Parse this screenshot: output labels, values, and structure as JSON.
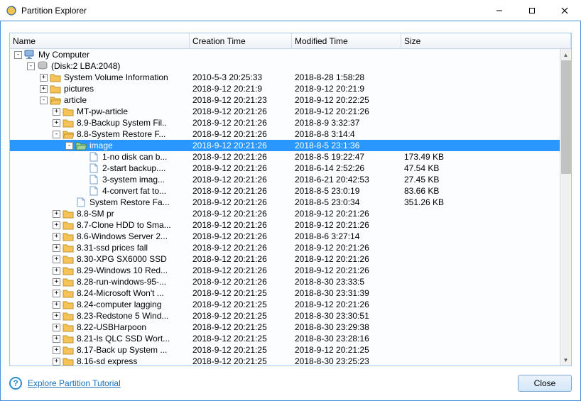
{
  "window": {
    "title": "Partition Explorer"
  },
  "columns": {
    "name": "Name",
    "ctime": "Creation Time",
    "mtime": "Modified Time",
    "size": "Size"
  },
  "footer": {
    "link": "Explore Partition Tutorial",
    "close": "Close"
  },
  "tree": [
    {
      "depth": 0,
      "exp": "-",
      "icon": "comp",
      "label": "My Computer",
      "ctime": "",
      "mtime": "",
      "size": ""
    },
    {
      "depth": 1,
      "exp": "-",
      "icon": "disk",
      "label": "(Disk:2 LBA:2048)",
      "ctime": "",
      "mtime": "",
      "size": ""
    },
    {
      "depth": 2,
      "exp": "+",
      "icon": "folder",
      "label": "System Volume Information",
      "ctime": "2010-5-3 20:25:33",
      "mtime": "2018-8-28 1:58:28",
      "size": ""
    },
    {
      "depth": 2,
      "exp": "+",
      "icon": "folder",
      "label": "pictures",
      "ctime": "2018-9-12 20:21:9",
      "mtime": "2018-9-12 20:21:9",
      "size": ""
    },
    {
      "depth": 2,
      "exp": "-",
      "icon": "folder-open",
      "label": "article",
      "ctime": "2018-9-12 20:21:23",
      "mtime": "2018-9-12 20:22:25",
      "size": ""
    },
    {
      "depth": 3,
      "exp": "+",
      "icon": "folder",
      "label": "MT-pw-article",
      "ctime": "2018-9-12 20:21:26",
      "mtime": "2018-9-12 20:21:26",
      "size": ""
    },
    {
      "depth": 3,
      "exp": "+",
      "icon": "folder",
      "label": "8.9-Backup System Fil..",
      "ctime": "2018-9-12 20:21:26",
      "mtime": "2018-8-9 3:32:37",
      "size": ""
    },
    {
      "depth": 3,
      "exp": "-",
      "icon": "folder-open",
      "label": "8.8-System Restore F...",
      "ctime": "2018-9-12 20:21:26",
      "mtime": "2018-8-8 3:14:4",
      "size": ""
    },
    {
      "depth": 4,
      "exp": "-",
      "icon": "folder-open",
      "label": "image",
      "ctime": "2018-9-12 20:21:26",
      "mtime": "2018-8-5 23:1:36",
      "size": "",
      "selected": true
    },
    {
      "depth": 5,
      "exp": "",
      "icon": "file",
      "label": "1-no disk can b...",
      "ctime": "2018-9-12 20:21:26",
      "mtime": "2018-8-5 19:22:47",
      "size": "173.49 KB"
    },
    {
      "depth": 5,
      "exp": "",
      "icon": "file",
      "label": "2-start backup....",
      "ctime": "2018-9-12 20:21:26",
      "mtime": "2018-6-14 2:52:26",
      "size": "47.54 KB"
    },
    {
      "depth": 5,
      "exp": "",
      "icon": "file",
      "label": "3-system imag...",
      "ctime": "2018-9-12 20:21:26",
      "mtime": "2018-6-21 20:42:53",
      "size": "27.45 KB"
    },
    {
      "depth": 5,
      "exp": "",
      "icon": "file",
      "label": "4-convert fat to...",
      "ctime": "2018-9-12 20:21:26",
      "mtime": "2018-8-5 23:0:19",
      "size": "83.66 KB"
    },
    {
      "depth": 4,
      "exp": "",
      "icon": "file",
      "label": "System Restore Fa...",
      "ctime": "2018-9-12 20:21:26",
      "mtime": "2018-8-5 23:0:34",
      "size": "351.26 KB"
    },
    {
      "depth": 3,
      "exp": "+",
      "icon": "folder",
      "label": "8.8-SM pr",
      "ctime": "2018-9-12 20:21:26",
      "mtime": "2018-9-12 20:21:26",
      "size": ""
    },
    {
      "depth": 3,
      "exp": "+",
      "icon": "folder",
      "label": "8.7-Clone HDD to Sma...",
      "ctime": "2018-9-12 20:21:26",
      "mtime": "2018-9-12 20:21:26",
      "size": ""
    },
    {
      "depth": 3,
      "exp": "+",
      "icon": "folder",
      "label": "8.6-Windows Server 2...",
      "ctime": "2018-9-12 20:21:26",
      "mtime": "2018-8-6 3:27:14",
      "size": ""
    },
    {
      "depth": 3,
      "exp": "+",
      "icon": "folder",
      "label": "8.31-ssd prices fall",
      "ctime": "2018-9-12 20:21:26",
      "mtime": "2018-9-12 20:21:26",
      "size": ""
    },
    {
      "depth": 3,
      "exp": "+",
      "icon": "folder",
      "label": "8.30-XPG SX6000 SSD",
      "ctime": "2018-9-12 20:21:26",
      "mtime": "2018-9-12 20:21:26",
      "size": ""
    },
    {
      "depth": 3,
      "exp": "+",
      "icon": "folder",
      "label": "8.29-Windows 10 Red...",
      "ctime": "2018-9-12 20:21:26",
      "mtime": "2018-9-12 20:21:26",
      "size": ""
    },
    {
      "depth": 3,
      "exp": "+",
      "icon": "folder",
      "label": "8.28-run-windows-95-...",
      "ctime": "2018-9-12 20:21:26",
      "mtime": "2018-8-30 23:33:5",
      "size": ""
    },
    {
      "depth": 3,
      "exp": "+",
      "icon": "folder",
      "label": "8.24-Microsoft Won't ...",
      "ctime": "2018-9-12 20:21:25",
      "mtime": "2018-8-30 23:31:39",
      "size": ""
    },
    {
      "depth": 3,
      "exp": "+",
      "icon": "folder",
      "label": "8.24-computer lagging",
      "ctime": "2018-9-12 20:21:25",
      "mtime": "2018-9-12 20:21:26",
      "size": ""
    },
    {
      "depth": 3,
      "exp": "+",
      "icon": "folder",
      "label": "8.23-Redstone 5 Wind...",
      "ctime": "2018-9-12 20:21:25",
      "mtime": "2018-8-30 23:30:51",
      "size": ""
    },
    {
      "depth": 3,
      "exp": "+",
      "icon": "folder",
      "label": "8.22-USBHarpoon",
      "ctime": "2018-9-12 20:21:25",
      "mtime": "2018-8-30 23:29:38",
      "size": ""
    },
    {
      "depth": 3,
      "exp": "+",
      "icon": "folder",
      "label": "8.21-Is QLC SSD Wort...",
      "ctime": "2018-9-12 20:21:25",
      "mtime": "2018-8-30 23:28:16",
      "size": ""
    },
    {
      "depth": 3,
      "exp": "+",
      "icon": "folder",
      "label": "8.17-Back up System ...",
      "ctime": "2018-9-12 20:21:25",
      "mtime": "2018-9-12 20:21:25",
      "size": ""
    },
    {
      "depth": 3,
      "exp": "+",
      "icon": "folder",
      "label": "8.16-sd express",
      "ctime": "2018-9-12 20:21:25",
      "mtime": "2018-8-30 23:25:23",
      "size": ""
    }
  ]
}
